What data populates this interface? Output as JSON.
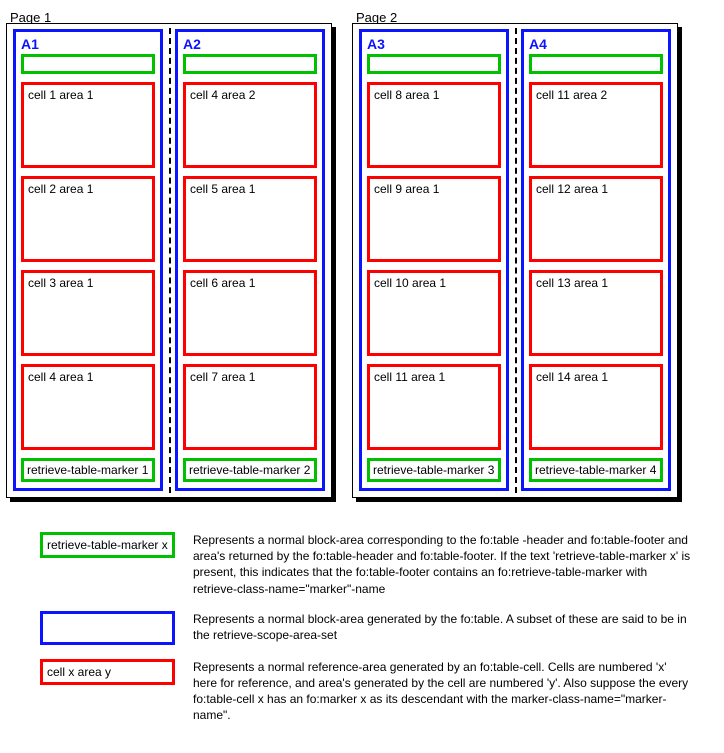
{
  "pages": [
    {
      "title": "Page 1",
      "columns": [
        {
          "areaLabel": "A1",
          "cells": [
            "cell 1 area 1",
            "cell 2 area 1",
            "cell 3 area 1",
            "cell 4 area 1"
          ],
          "footer": "retrieve-table-marker 1"
        },
        {
          "areaLabel": "A2",
          "cells": [
            "cell 4 area 2",
            "cell 5 area 1",
            "cell 6 area 1",
            "cell 7 area 1"
          ],
          "footer": "retrieve-table-marker 2"
        }
      ]
    },
    {
      "title": "Page 2",
      "columns": [
        {
          "areaLabel": "A3",
          "cells": [
            "cell 8 area 1",
            "cell 9 area 1",
            "cell 10 area 1",
            "cell 11 area 1"
          ],
          "footer": "retrieve-table-marker 3"
        },
        {
          "areaLabel": "A4",
          "cells": [
            "cell 11 area 2",
            "cell 12 area 1",
            "cell 13 area 1",
            "cell 14 area 1"
          ],
          "footer": "retrieve-table-marker 4"
        }
      ]
    }
  ],
  "legend": {
    "green": {
      "swatch": "retrieve-table-marker x",
      "text": "Represents a normal block-area corresponding to the fo:table -header and fo:table-footer and area's returned by the fo:table-header and fo:table-footer. If the text 'retrieve-table-marker x' is present, this indicates that the fo:table-footer contains an fo:retrieve-table-marker with retrieve-class-name=\"marker\"-name"
    },
    "blue": {
      "text": "Represents a normal block-area generated by the fo:table. A subset of these are said to be in the retrieve-scope-area-set"
    },
    "red": {
      "swatch": "cell x area y",
      "text": "Represents a normal reference-area generated by an fo:table-cell. Cells are numbered 'x' here for reference, and area's generated by the cell are numbered 'y'. Also suppose the every fo:table-cell x has an fo:marker x as its descendant with the marker-class-name=\"marker-name\"."
    }
  }
}
